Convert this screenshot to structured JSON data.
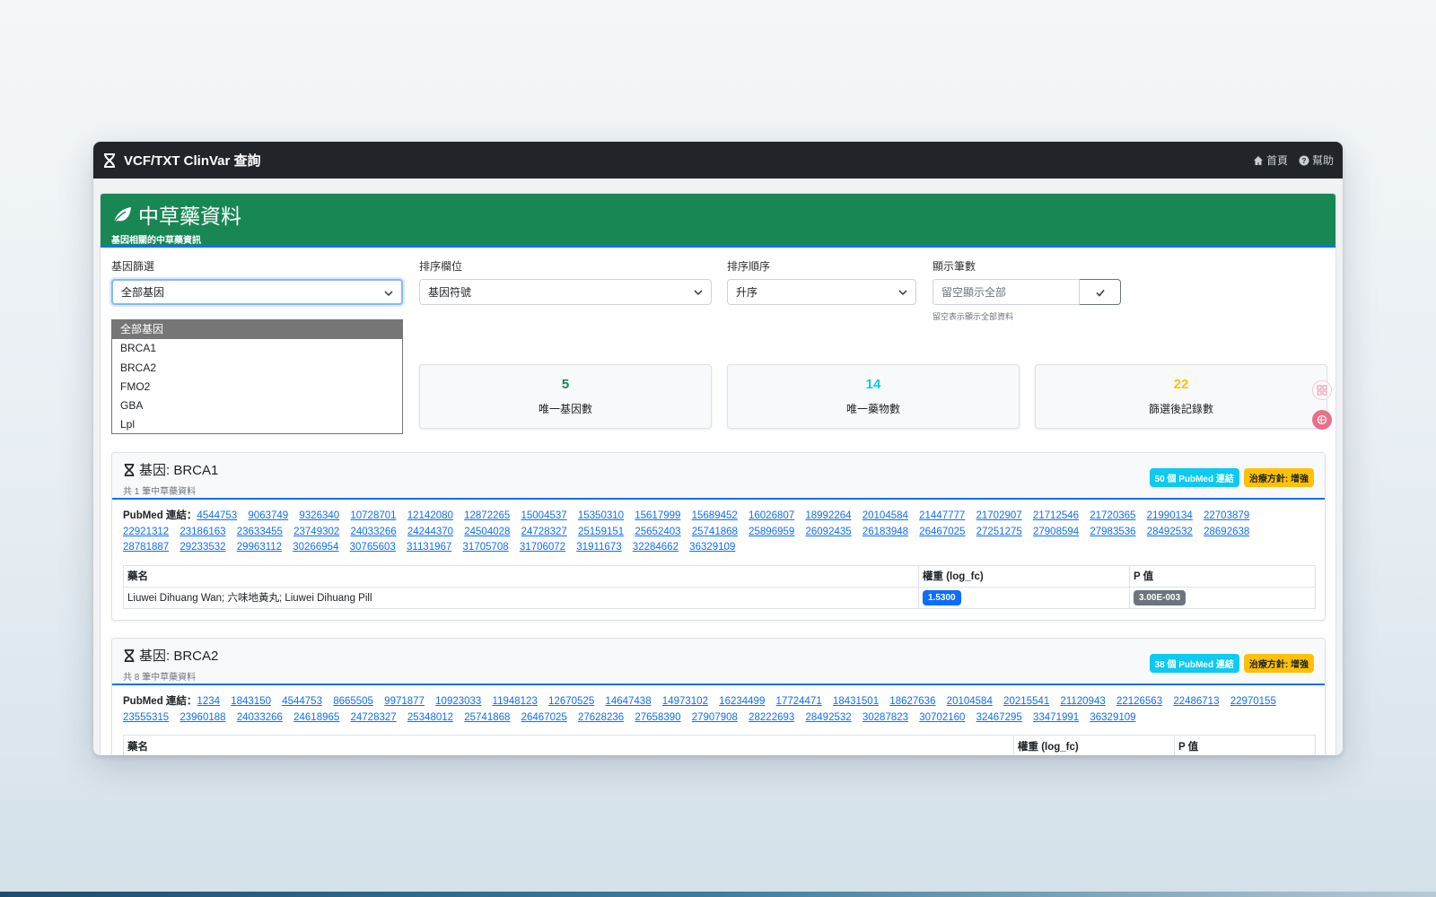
{
  "navbar": {
    "title": "VCF/TXT ClinVar 查詢",
    "home_label": "首頁",
    "help_label": "幫助"
  },
  "card": {
    "title": "中草藥資料",
    "subtitle": "基因相關的中草藥資訊"
  },
  "filters": {
    "gene_label": "基因篩選",
    "gene_value": "全部基因",
    "sort_field_label": "排序欄位",
    "sort_field_value": "基因符號",
    "sort_order_label": "排序順序",
    "sort_order_value": "升序",
    "limit_label": "顯示筆數",
    "limit_placeholder": "留空顯示全部",
    "limit_help": "留空表示顯示全部資料"
  },
  "gene_options": [
    "全部基因",
    "BRCA1",
    "BRCA2",
    "FMO2",
    "GBA",
    "Lpl"
  ],
  "stats": [
    {
      "value": "5",
      "label": "唯一基因數",
      "color": "#198754"
    },
    {
      "value": "14",
      "label": "唯一藥物數",
      "color": "#0dcaf0"
    },
    {
      "value": "22",
      "label": "篩選後記錄數",
      "color": "#ffc107"
    }
  ],
  "gene_cards": [
    {
      "title": "基因: BRCA1",
      "count": "共 1 筆中草藥資料",
      "pubmed_badge": "50 個 PubMed 連結",
      "strategy_badge": "治療方針: 增強",
      "pubmed_label": "PubMed 連結：",
      "pubmed_links": [
        "4544753",
        "9063749",
        "9326340",
        "10728701",
        "12142080",
        "12872265",
        "15004537",
        "15350310",
        "15617999",
        "15689452",
        "16026807",
        "18992264",
        "20104584",
        "21447777",
        "21702907",
        "21712546",
        "21720365",
        "21990134",
        "22703879",
        "22921312",
        "23186163",
        "23633455",
        "23749302",
        "24033266",
        "24244370",
        "24504028",
        "24728327",
        "25159151",
        "25652403",
        "25741868",
        "25896959",
        "26092435",
        "26183948",
        "26467025",
        "27251275",
        "27908594",
        "27983536",
        "28492532",
        "28692638",
        "28781887",
        "29233532",
        "29963112",
        "30266954",
        "30765603",
        "31131967",
        "31705708",
        "31706072",
        "31911673",
        "32284662",
        "36329109"
      ],
      "headers": [
        "藥名",
        "權重 (log_fc)",
        "P 值"
      ],
      "rows": [
        {
          "name": "Liuwei Dihuang Wan; 六味地黃丸; Liuwei Dihuang Pill",
          "weight": "1.5300",
          "pvalue": "3.00E-003"
        }
      ]
    },
    {
      "title": "基因: BRCA2",
      "count": "共 8 筆中草藥資料",
      "pubmed_badge": "38 個 PubMed 連結",
      "strategy_badge": "治療方針: 增強",
      "pubmed_label": "PubMed 連結：",
      "pubmed_links": [
        "1234",
        "1843150",
        "4544753",
        "8665505",
        "9971877",
        "10923033",
        "11948123",
        "12670525",
        "14647438",
        "14973102",
        "16234499",
        "17724471",
        "18431501",
        "18627636",
        "20104584",
        "20215541",
        "21120943",
        "22126563",
        "22486713",
        "22970155",
        "23555315",
        "23960188",
        "24033266",
        "24618965",
        "24728327",
        "25348012",
        "25741868",
        "26467025",
        "27628236",
        "27658390",
        "27907908",
        "28222693",
        "28492532",
        "30287823",
        "30702160",
        "32467295",
        "33471991",
        "36329109"
      ],
      "headers": [
        "藥名",
        "權重 (log_fc)",
        "P 值"
      ]
    }
  ]
}
